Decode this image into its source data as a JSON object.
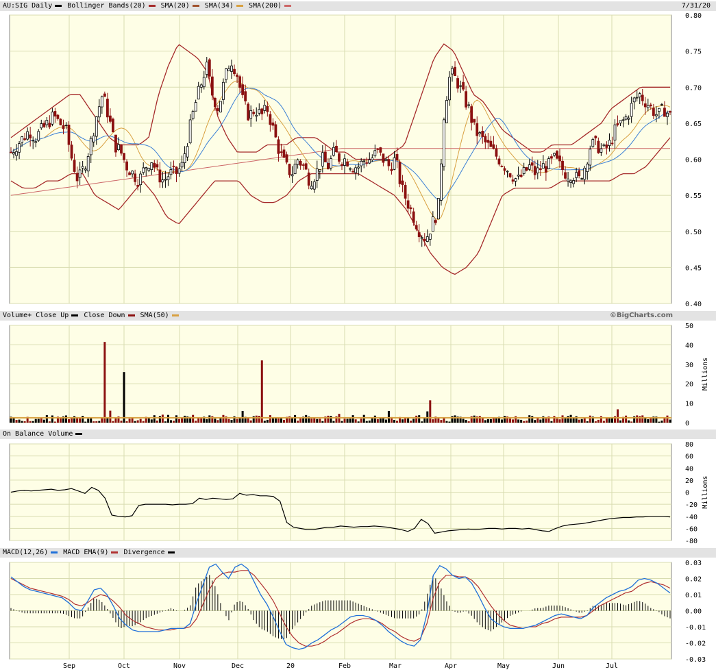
{
  "headers": {
    "price": {
      "items": [
        {
          "label": "AU:SIG Daily",
          "color": "#000000"
        },
        {
          "label": "Bollinger Bands(20)",
          "color": "#a52a2a"
        },
        {
          "label": "SMA(20)",
          "color": "#a0522d"
        },
        {
          "label": "SMA(34)",
          "color": "#d8a040"
        },
        {
          "label": "SMA(200)",
          "color": "#cc6666"
        }
      ],
      "date": "7/31/20"
    },
    "volume": {
      "items": [
        {
          "label": "Volume+ Close Up",
          "color": "#000000"
        },
        {
          "label": "Close Down",
          "color": "#8b1010"
        },
        {
          "label": "SMA(50)",
          "color": "#d8a040"
        }
      ],
      "credit": "©BigCharts.com"
    },
    "obv": {
      "items": [
        {
          "label": "On Balance Volume",
          "color": "#000000"
        }
      ]
    },
    "macd": {
      "items": [
        {
          "label": "MACD(12,26)",
          "color": "#1e6fd9"
        },
        {
          "label": "MACD EMA(9)",
          "color": "#b03030"
        },
        {
          "label": "Divergence",
          "color": "#000000"
        }
      ]
    }
  },
  "x_axis": {
    "labels": [
      "Sep",
      "Oct",
      "Nov",
      "Dec",
      "20",
      "Feb",
      "Mar",
      "Apr",
      "May",
      "Jun",
      "Jul"
    ]
  },
  "colors": {
    "plot_bg": "#fefee6",
    "grid": "#d8dcb0",
    "up": "#000000",
    "down": "#8b1010",
    "boll": "#a52a2a",
    "sma20": "#3a7fd5",
    "sma34": "#d8a040",
    "sma200": "#cc6666",
    "macd": "#1e6fd9",
    "macd_ema": "#b03030"
  },
  "chart_data": [
    {
      "type": "candlestick",
      "title": "AU:SIG Daily",
      "y_ticks": [
        "0.80",
        "0.75",
        "0.70",
        "0.65",
        "0.60",
        "0.55",
        "0.50",
        "0.45",
        "0.40"
      ],
      "ylim": [
        0.4,
        0.8
      ],
      "close": [
        0.61,
        0.62,
        0.63,
        0.64,
        0.63,
        0.64,
        0.65,
        0.66,
        0.65,
        0.64,
        0.6,
        0.57,
        0.59,
        0.62,
        0.66,
        0.69,
        0.66,
        0.62,
        0.61,
        0.59,
        0.58,
        0.57,
        0.59,
        0.6,
        0.58,
        0.57,
        0.58,
        0.58,
        0.59,
        0.63,
        0.67,
        0.7,
        0.73,
        0.69,
        0.67,
        0.71,
        0.74,
        0.72,
        0.68,
        0.66,
        0.67,
        0.66,
        0.67,
        0.64,
        0.61,
        0.59,
        0.58,
        0.6,
        0.59,
        0.57,
        0.58,
        0.6,
        0.59,
        0.61,
        0.6,
        0.6,
        0.59,
        0.59,
        0.6,
        0.6,
        0.61,
        0.6,
        0.59,
        0.6,
        0.56,
        0.54,
        0.52,
        0.5,
        0.49,
        0.51,
        0.53,
        0.67,
        0.72,
        0.71,
        0.69,
        0.67,
        0.64,
        0.63,
        0.62,
        0.61,
        0.6,
        0.59,
        0.58,
        0.57,
        0.58,
        0.59,
        0.58,
        0.59,
        0.59,
        0.6,
        0.59,
        0.58,
        0.58,
        0.57,
        0.59,
        0.62,
        0.62,
        0.61,
        0.62,
        0.64,
        0.65,
        0.66,
        0.68,
        0.69,
        0.68,
        0.67,
        0.66,
        0.67,
        0.66
      ],
      "bollinger_upper": [
        0.63,
        0.64,
        0.65,
        0.66,
        0.67,
        0.68,
        0.69,
        0.69,
        0.67,
        0.65,
        0.63,
        0.62,
        0.62,
        0.62,
        0.63,
        0.69,
        0.73,
        0.76,
        0.75,
        0.74,
        0.72,
        0.66,
        0.63,
        0.61,
        0.61,
        0.61,
        0.62,
        0.62,
        0.62,
        0.63,
        0.63,
        0.63,
        0.62,
        0.61,
        0.61,
        0.6,
        0.6,
        0.6,
        0.6,
        0.61,
        0.62,
        0.66,
        0.7,
        0.74,
        0.76,
        0.75,
        0.72,
        0.69,
        0.68,
        0.66,
        0.64,
        0.63,
        0.62,
        0.61,
        0.61,
        0.62,
        0.62,
        0.62,
        0.63,
        0.64,
        0.65,
        0.67,
        0.68,
        0.69,
        0.7,
        0.7,
        0.7,
        0.7
      ],
      "bollinger_lower": [
        0.57,
        0.56,
        0.56,
        0.57,
        0.57,
        0.58,
        0.58,
        0.55,
        0.54,
        0.53,
        0.55,
        0.57,
        0.55,
        0.52,
        0.51,
        0.53,
        0.55,
        0.57,
        0.57,
        0.57,
        0.55,
        0.54,
        0.54,
        0.55,
        0.57,
        0.58,
        0.58,
        0.58,
        0.58,
        0.58,
        0.57,
        0.56,
        0.55,
        0.53,
        0.5,
        0.47,
        0.45,
        0.44,
        0.45,
        0.47,
        0.51,
        0.55,
        0.56,
        0.56,
        0.56,
        0.56,
        0.57,
        0.57,
        0.57,
        0.57,
        0.57,
        0.58,
        0.58,
        0.59,
        0.61,
        0.63
      ]
    },
    {
      "type": "bar",
      "title": "Volume",
      "ylabel": "Millions",
      "y_ticks": [
        "50",
        "40",
        "30",
        "20",
        "10",
        "0"
      ],
      "ylim": [
        0,
        50
      ],
      "spikes": [
        {
          "month": "Sep",
          "value": 41.5,
          "direction": "down"
        },
        {
          "month": "Oct",
          "value": 26,
          "direction": "up"
        },
        {
          "month": "Dec",
          "value": 32,
          "direction": "down"
        },
        {
          "month": "Mar",
          "value": 11.5,
          "direction": "down"
        }
      ],
      "sma50_level": 2.5
    },
    {
      "type": "line",
      "title": "On Balance Volume",
      "ylabel": "Millions",
      "y_ticks": [
        "80",
        "60",
        "40",
        "20",
        "0",
        "-20",
        "-40",
        "-60",
        "-80"
      ],
      "ylim": [
        -80,
        80
      ],
      "values": [
        0,
        2,
        3,
        2,
        3,
        4,
        5,
        3,
        4,
        6,
        2,
        -2,
        8,
        3,
        -10,
        -38,
        -40,
        -41,
        -39,
        -22,
        -20,
        -20,
        -20,
        -20,
        -21,
        -20,
        -20,
        -19,
        -10,
        -12,
        -10,
        -11,
        -12,
        -11,
        -2,
        -5,
        -4,
        -6,
        -6,
        -7,
        -15,
        -50,
        -58,
        -60,
        -62,
        -62,
        -60,
        -58,
        -58,
        -56,
        -57,
        -58,
        -57,
        -57,
        -56,
        -57,
        -58,
        -60,
        -62,
        -65,
        -60,
        -45,
        -52,
        -68,
        -66,
        -64,
        -63,
        -62,
        -61,
        -62,
        -61,
        -60,
        -60,
        -61,
        -60,
        -60,
        -61,
        -60,
        -62,
        -64,
        -65,
        -60,
        -56,
        -54,
        -53,
        -52,
        -50,
        -48,
        -46,
        -44,
        -43,
        -42,
        -42,
        -41,
        -41,
        -40,
        -40,
        -40,
        -41
      ]
    },
    {
      "type": "line",
      "title": "MACD(12,26)",
      "y_ticks": [
        "0.03",
        "0.02",
        "0.01",
        "0.00",
        "-0.01",
        "-0.02",
        "-0.03"
      ],
      "ylim": [
        -0.03,
        0.03
      ],
      "macd": [
        0.021,
        0.018,
        0.015,
        0.013,
        0.012,
        0.011,
        0.01,
        0.009,
        0.008,
        0.005,
        0.001,
        0.0,
        0.006,
        0.013,
        0.014,
        0.01,
        0.003,
        -0.005,
        -0.009,
        -0.012,
        -0.013,
        -0.013,
        -0.013,
        -0.013,
        -0.012,
        -0.011,
        -0.011,
        -0.011,
        -0.008,
        0.005,
        0.016,
        0.027,
        0.029,
        0.024,
        0.02,
        0.027,
        0.029,
        0.026,
        0.018,
        0.01,
        0.004,
        -0.004,
        -0.013,
        -0.021,
        -0.023,
        -0.024,
        -0.023,
        -0.02,
        -0.018,
        -0.015,
        -0.012,
        -0.01,
        -0.007,
        -0.004,
        -0.003,
        -0.003,
        -0.004,
        -0.006,
        -0.009,
        -0.013,
        -0.016,
        -0.019,
        -0.021,
        -0.022,
        -0.018,
        -0.002,
        0.022,
        0.028,
        0.026,
        0.022,
        0.02,
        0.021,
        0.017,
        0.01,
        0.002,
        -0.005,
        -0.008,
        -0.01,
        -0.011,
        -0.011,
        -0.011,
        -0.01,
        -0.009,
        -0.007,
        -0.005,
        -0.003,
        -0.002,
        -0.003,
        -0.004,
        -0.005,
        -0.003,
        0.002,
        0.005,
        0.008,
        0.01,
        0.012,
        0.013,
        0.015,
        0.019,
        0.02,
        0.019,
        0.017,
        0.014,
        0.011
      ],
      "macd_ema": [
        0.02,
        0.018,
        0.016,
        0.014,
        0.013,
        0.012,
        0.011,
        0.01,
        0.009,
        0.007,
        0.004,
        0.003,
        0.005,
        0.008,
        0.01,
        0.009,
        0.006,
        0.002,
        -0.003,
        -0.006,
        -0.008,
        -0.01,
        -0.011,
        -0.012,
        -0.012,
        -0.012,
        -0.011,
        -0.011,
        -0.01,
        -0.005,
        0.004,
        0.013,
        0.02,
        0.023,
        0.024,
        0.024,
        0.025,
        0.025,
        0.022,
        0.017,
        0.012,
        0.006,
        -0.002,
        -0.01,
        -0.016,
        -0.02,
        -0.022,
        -0.022,
        -0.021,
        -0.019,
        -0.016,
        -0.014,
        -0.011,
        -0.008,
        -0.006,
        -0.005,
        -0.005,
        -0.006,
        -0.008,
        -0.011,
        -0.013,
        -0.016,
        -0.018,
        -0.019,
        -0.017,
        -0.008,
        0.008,
        0.018,
        0.022,
        0.022,
        0.021,
        0.021,
        0.019,
        0.015,
        0.009,
        0.003,
        -0.002,
        -0.006,
        -0.009,
        -0.01,
        -0.011,
        -0.01,
        -0.01,
        -0.008,
        -0.007,
        -0.005,
        -0.004,
        -0.004,
        -0.004,
        -0.004,
        -0.003,
        0.0,
        0.003,
        0.005,
        0.007,
        0.009,
        0.011,
        0.012,
        0.015,
        0.017,
        0.018,
        0.017,
        0.016,
        0.014
      ]
    }
  ]
}
